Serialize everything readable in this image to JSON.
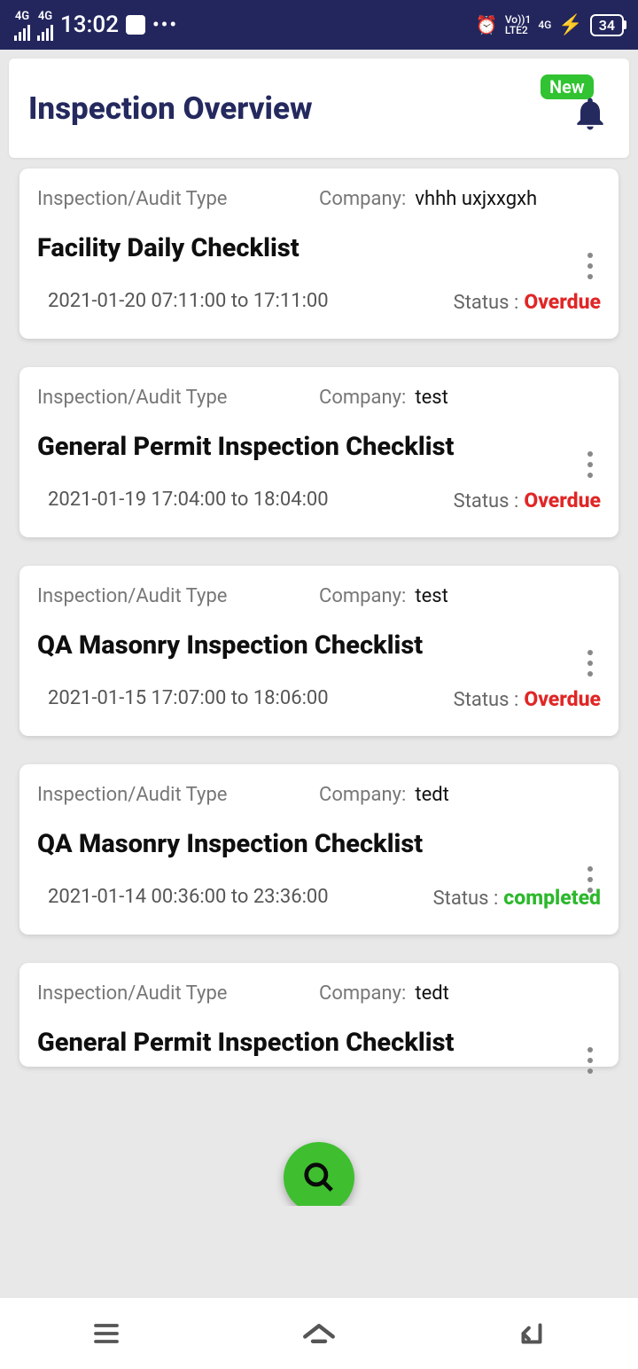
{
  "statusBar": {
    "time": "13:02",
    "battery": "34",
    "net1": "4G",
    "net2": "4G",
    "lte": "LTE2",
    "vo": "Vo))1",
    "fourG": "4G"
  },
  "header": {
    "title": "Inspection Overview",
    "newBadge": "New"
  },
  "labels": {
    "type": "Inspection/Audit Type",
    "company": "Company:",
    "status": "Status :"
  },
  "cards": [
    {
      "company": "vhhh uxjxxgxh",
      "title": "Facility Daily Checklist",
      "datetime": "2021-01-20  07:11:00 to 17:11:00",
      "status": "Overdue",
      "statusClass": "overdue"
    },
    {
      "company": "test",
      "title": "General Permit Inspection Checklist",
      "datetime": "2021-01-19  17:04:00 to 18:04:00",
      "status": "Overdue",
      "statusClass": "overdue"
    },
    {
      "company": "test",
      "title": "QA Masonry Inspection Checklist",
      "datetime": "2021-01-15  17:07:00 to 18:06:00",
      "status": "Overdue",
      "statusClass": "overdue"
    },
    {
      "company": "tedt",
      "title": "QA Masonry Inspection Checklist",
      "datetime": "2021-01-14  00:36:00 to 23:36:00",
      "status": "completed",
      "statusClass": "completed"
    },
    {
      "company": "tedt",
      "title": "General Permit Inspection Checklist",
      "datetime": "",
      "status": "",
      "statusClass": "overdue"
    }
  ]
}
